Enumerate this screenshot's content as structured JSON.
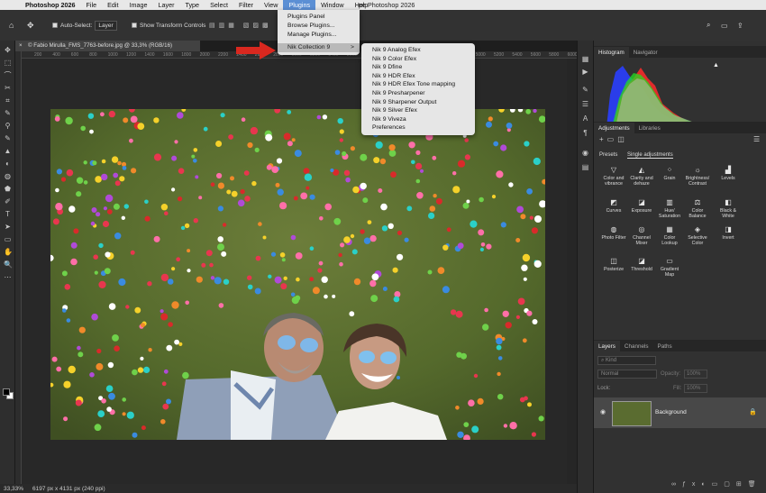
{
  "menubar": {
    "app": "Photoshop 2026",
    "items": [
      "File",
      "Edit",
      "Image",
      "Layer",
      "Type",
      "Select",
      "Filter",
      "View",
      "Plugins",
      "Window",
      "Help"
    ],
    "window_title": "pe Photoshop 2026"
  },
  "plugins_menu": {
    "items": [
      "Plugins Panel",
      "Browse Plugins...",
      "Manage Plugins...",
      "Nik Collection 9"
    ],
    "submenu_arrow": ">"
  },
  "nik_menu": {
    "items": [
      "Nik 9 Analog Efex",
      "Nik 9 Color Efex",
      "Nik 9 Dfine",
      "Nik 9 HDR Efex",
      "Nik 9 HDR Efex Tone mapping",
      "Nik 9 Presharpener",
      "Nik 9 Sharpener Output",
      "Nik 9 Silver Efex",
      "Nik 9 Viveza",
      "Preferences"
    ]
  },
  "options_bar": {
    "auto_select_label": "Auto-Select:",
    "auto_select_value": "Layer",
    "transform_label": "Show Transform Controls"
  },
  "document": {
    "tab_title": "© Fabio Mirulla_FMS_7763-before.jpg @ 33,3% (RGB/16)",
    "close_icon": "×"
  },
  "ruler_labels": [
    "200",
    "400",
    "600",
    "800",
    "1000",
    "1200",
    "1400",
    "1600",
    "1800",
    "2000",
    "2200",
    "2400",
    "2600",
    "2800",
    "3000",
    "3200",
    "3400",
    "3600",
    "3800",
    "4000",
    "4200",
    "4400",
    "4600",
    "4800",
    "5000",
    "5200",
    "5400",
    "5600",
    "5800",
    "6000",
    "6200"
  ],
  "status": {
    "zoom": "33,33%",
    "info": "6197 px x 4131 px (240 ppi)"
  },
  "histogram_panel": {
    "tabs": [
      "Histogram",
      "Navigator"
    ],
    "warning": "▲"
  },
  "adjustments_panel": {
    "tabs": [
      "Adjustments",
      "Libraries"
    ],
    "subtabs": [
      "Presets",
      "Single adjustments"
    ],
    "items": [
      [
        "Color and vibrance",
        "Clarity and dehaze",
        "Grain",
        "Brightness/ Contrast",
        "Levels"
      ],
      [
        "Curves",
        "Exposure",
        "Hue/ Saturation",
        "Color Balance",
        "Black & White"
      ],
      [
        "Photo Filter",
        "Channel Mixer",
        "Color Lookup",
        "Selective Color",
        "Invert"
      ],
      [
        "Posterize",
        "Threshold",
        "Gradient Map"
      ]
    ]
  },
  "layers_panel": {
    "tabs": [
      "Layers",
      "Channels",
      "Paths"
    ],
    "kind_label": "Kind",
    "blend_mode": "Normal",
    "opacity_label": "Opacity:",
    "opacity_value": "100%",
    "lock_label": "Lock:",
    "fill_label": "Fill:",
    "fill_value": "100%",
    "layer_name": "Background"
  },
  "colors": {
    "menu_highlight": "#5b8fd4",
    "submenu_selected": "#b9b9b9",
    "arrow_red": "#d9281f",
    "panel_bg": "#313131"
  }
}
